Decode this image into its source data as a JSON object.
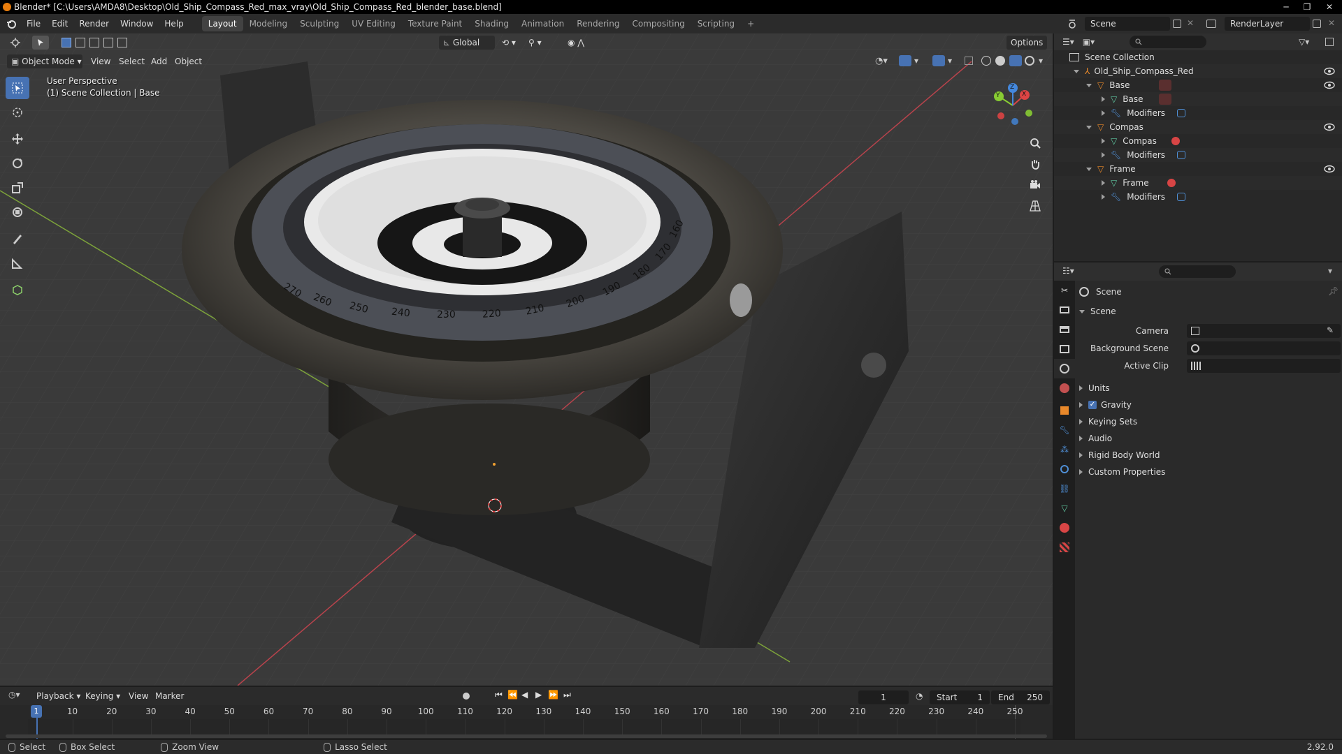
{
  "titlebar": {
    "title": "Blender* [C:\\Users\\AMDA8\\Desktop\\Old_Ship_Compass_Red_max_vray\\Old_Ship_Compass_Red_blender_base.blend]",
    "minimize": "─",
    "maximize": "❐",
    "close": "✕"
  },
  "menu": {
    "items": [
      "File",
      "Edit",
      "Render",
      "Window",
      "Help"
    ]
  },
  "workspaces": {
    "tabs": [
      "Layout",
      "Modeling",
      "Sculpting",
      "UV Editing",
      "Texture Paint",
      "Shading",
      "Animation",
      "Rendering",
      "Compositing",
      "Scripting"
    ],
    "add": "+"
  },
  "scene_selector": {
    "value": "Scene"
  },
  "render_layer": {
    "value": "RenderLayer"
  },
  "viewport": {
    "mode": "Object Mode",
    "menus": [
      "View",
      "Select",
      "Add",
      "Object"
    ],
    "transform_orientation": "Global",
    "options": "Options",
    "overlay_line1": "User Perspective",
    "overlay_line2": "(1) Scene Collection | Base",
    "gizmo": {
      "x": "X",
      "y": "Y",
      "z": "Z"
    },
    "dial_numbers": [
      "270",
      "260",
      "250",
      "240",
      "230",
      "220",
      "210",
      "200",
      "190",
      "180",
      "170",
      "160"
    ]
  },
  "outliner": {
    "rows": [
      {
        "label": "Scene Collection"
      },
      {
        "label": "Old_Ship_Compass_Red"
      },
      {
        "label": "Base"
      },
      {
        "label": "Base"
      },
      {
        "label": "Modifiers"
      },
      {
        "label": "Compas"
      },
      {
        "label": "Compas"
      },
      {
        "label": "Modifiers"
      },
      {
        "label": "Frame"
      },
      {
        "label": "Frame"
      },
      {
        "label": "Modifiers"
      }
    ]
  },
  "properties": {
    "context": "Scene",
    "panel_title": "Scene",
    "fields": [
      {
        "label": "Camera"
      },
      {
        "label": "Background Scene"
      },
      {
        "label": "Active Clip"
      }
    ],
    "panels": [
      "Units",
      "Gravity",
      "Keying Sets",
      "Audio",
      "Rigid Body World",
      "Custom Properties"
    ],
    "gravity_checked": true
  },
  "timeline": {
    "menus": [
      "Playback",
      "Keying",
      "View",
      "Marker"
    ],
    "current_frame": "1",
    "start_label": "Start",
    "start": "1",
    "end_label": "End",
    "end": "250",
    "ticks": [
      "1",
      "10",
      "20",
      "30",
      "40",
      "50",
      "60",
      "70",
      "80",
      "90",
      "100",
      "110",
      "120",
      "130",
      "140",
      "150",
      "160",
      "170",
      "180",
      "190",
      "200",
      "210",
      "220",
      "230",
      "240",
      "250"
    ]
  },
  "status": {
    "select": "Select",
    "box_select": "Box Select",
    "zoom_view": "Zoom View",
    "lasso_select": "Lasso Select",
    "version": "2.92.0"
  },
  "colors": {
    "accent": "#4772b3",
    "object_orange": "#e8882a",
    "mesh_green": "#5fc7a0",
    "modifier_blue": "#4f8fd6",
    "material_red": "#d84545"
  }
}
